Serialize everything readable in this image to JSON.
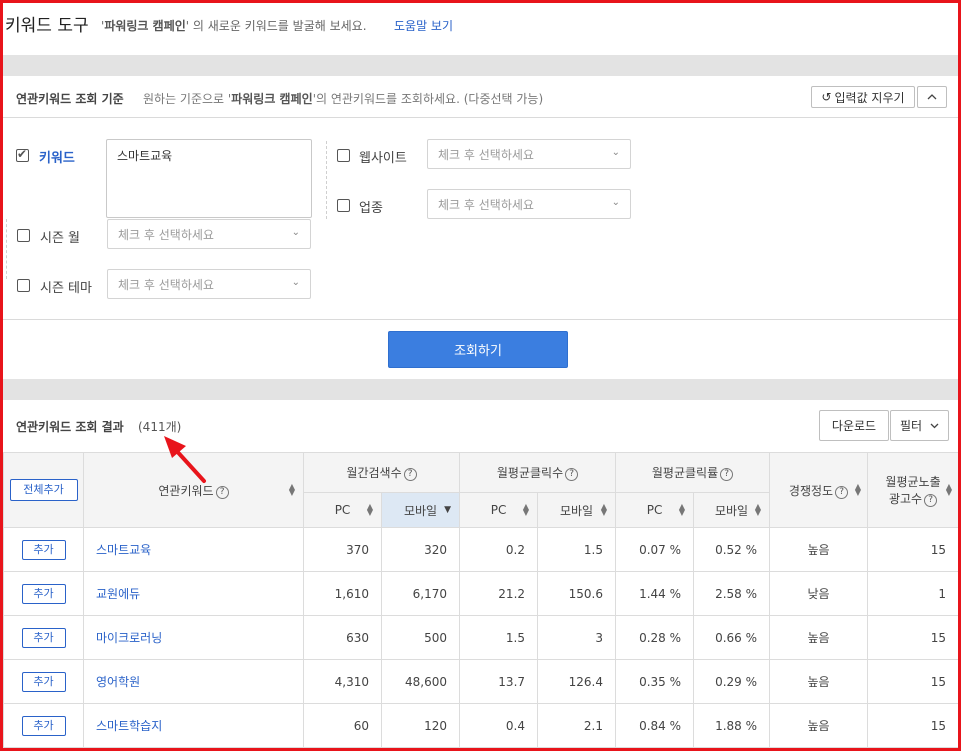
{
  "top": {
    "title": "키워드 도구",
    "desc_prefix": "'",
    "desc_bold": "파워링크 캠페인",
    "desc_rest": "' 의 새로운 키워드를 발굴해 보세요.",
    "help_link": "도움말 보기"
  },
  "condition": {
    "label": "연관키워드 조회 기준",
    "sub_pre": "원하는 기준으로 '",
    "sub_bold": "파워링크 캠페인",
    "sub_post": "'의 연관키워드를 조회하세요. (다중선택 가능)",
    "reset_label": "입력값 지우기",
    "collapse_icon": "chevron-up-icon",
    "keyword_label": "키워드",
    "keyword_value": "스마트교육",
    "website_label": "웹사이트",
    "industry_label": "업종",
    "season_month_label": "시즌 월",
    "season_theme_label": "시즌 테마",
    "select_placeholder": "체크 후 선택하세요",
    "search_button": "조회하기"
  },
  "result": {
    "label": "연관키워드 조회 결과",
    "count": "(411개)",
    "download_label": "다운로드",
    "filter_label": "필터",
    "columns": {
      "add_all": "전체추가",
      "keyword": "연관키워드",
      "monthly_search": "월간검색수",
      "monthly_clicks": "월평균클릭수",
      "monthly_ctr": "월평균클릭률",
      "competition": "경쟁정도",
      "ads_line1": "월평균노출",
      "ads_line2": "광고수",
      "pc": "PC",
      "mobile": "모바일"
    },
    "add_label": "추가",
    "rows": [
      {
        "keyword": "스마트교육",
        "search_pc": "370",
        "search_mobile": "320",
        "click_pc": "0.2",
        "click_mobile": "1.5",
        "ctr_pc": "0.07 %",
        "ctr_mobile": "0.52 %",
        "competition": "높음",
        "ads": "15"
      },
      {
        "keyword": "교원에듀",
        "search_pc": "1,610",
        "search_mobile": "6,170",
        "click_pc": "21.2",
        "click_mobile": "150.6",
        "ctr_pc": "1.44 %",
        "ctr_mobile": "2.58 %",
        "competition": "낮음",
        "ads": "1"
      },
      {
        "keyword": "마이크로러닝",
        "search_pc": "630",
        "search_mobile": "500",
        "click_pc": "1.5",
        "click_mobile": "3",
        "ctr_pc": "0.28 %",
        "ctr_mobile": "0.66 %",
        "competition": "높음",
        "ads": "15"
      },
      {
        "keyword": "영어학원",
        "search_pc": "4,310",
        "search_mobile": "48,600",
        "click_pc": "13.7",
        "click_mobile": "126.4",
        "ctr_pc": "0.35 %",
        "ctr_mobile": "0.29 %",
        "competition": "높음",
        "ads": "15"
      },
      {
        "keyword": "스마트학습지",
        "search_pc": "60",
        "search_mobile": "120",
        "click_pc": "0.4",
        "click_mobile": "2.1",
        "ctr_pc": "0.84 %",
        "ctr_mobile": "1.88 %",
        "competition": "높음",
        "ads": "15"
      }
    ]
  },
  "colors": {
    "accent_blue": "#3b7ee0",
    "link_blue": "#2a62c9",
    "frame_red": "#e8141b",
    "arrow_red": "#e8141b"
  }
}
